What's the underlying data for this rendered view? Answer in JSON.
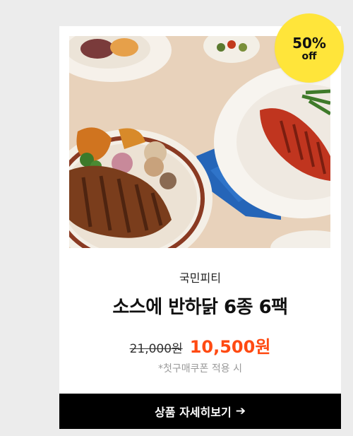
{
  "badge": {
    "discount": "50%",
    "off_label": "off"
  },
  "product": {
    "brand": "국민피티",
    "title": "소스에 반하닭 6종 6팩",
    "original_price": "21,000원",
    "sale_price": "10,500원",
    "note": "*첫구매쿠폰 적용 시",
    "image_icon": "food-photo"
  },
  "cta": {
    "label": "상품 자세히보기",
    "arrow_icon": "arrow-right-icon"
  },
  "colors": {
    "badge_bg": "#ffe53a",
    "sale_price": "#ff4a12",
    "cta_bg": "#000000",
    "page_bg": "#ececec"
  }
}
